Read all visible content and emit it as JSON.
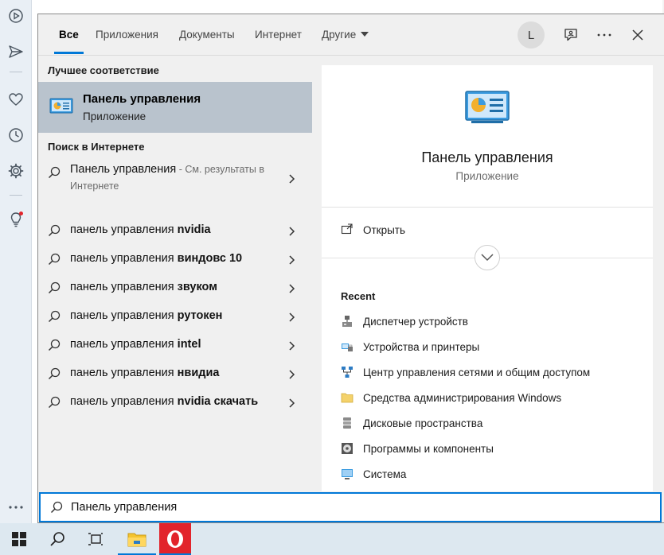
{
  "tabs": {
    "all": "Все",
    "apps": "Приложения",
    "documents": "Документы",
    "internet": "Интернет",
    "other": "Другие"
  },
  "user": {
    "avatar_letter": "L"
  },
  "results": {
    "best_match_heading": "Лучшее соответствие",
    "best_match": {
      "title": "Панель управления",
      "subtitle": "Приложение",
      "icon": "control-panel-icon"
    },
    "web_heading": "Поиск в Интернете",
    "web_first": {
      "query": "Панель управления",
      "note": " - См. результаты в Интернете"
    },
    "web_suggestions": [
      {
        "prefix": "панель управления ",
        "bold": "nvidia"
      },
      {
        "prefix": "панель управления ",
        "bold": "виндовс 10"
      },
      {
        "prefix": "панель управления ",
        "bold": "звуком"
      },
      {
        "prefix": "панель управления ",
        "bold": "рутокен"
      },
      {
        "prefix": "панель управления ",
        "bold": "intel"
      },
      {
        "prefix": "панель управления ",
        "bold": "нвидиа"
      },
      {
        "prefix": "панель управления ",
        "bold": "nvidia скачать"
      }
    ]
  },
  "detail": {
    "title": "Панель управления",
    "subtitle": "Приложение",
    "open_label": "Открыть",
    "recent_heading": "Recent",
    "recent": [
      {
        "label": "Диспетчер устройств",
        "icon": "device-manager-icon"
      },
      {
        "label": "Устройства и принтеры",
        "icon": "devices-printers-icon"
      },
      {
        "label": "Центр управления сетями и общим доступом",
        "icon": "network-center-icon"
      },
      {
        "label": "Средства администрирования Windows",
        "icon": "folder-icon"
      },
      {
        "label": "Дисковые пространства",
        "icon": "storage-spaces-icon"
      },
      {
        "label": "Программы и компоненты",
        "icon": "programs-icon"
      },
      {
        "label": "Система",
        "icon": "system-icon"
      }
    ]
  },
  "search": {
    "value": "Панель управления"
  },
  "colors": {
    "accent": "#0078d7",
    "selected_bg": "#b9c3cd",
    "panel_bg": "#f0f0f0",
    "taskbar_bg": "#dde8f0",
    "opera_red": "#e2242b"
  }
}
